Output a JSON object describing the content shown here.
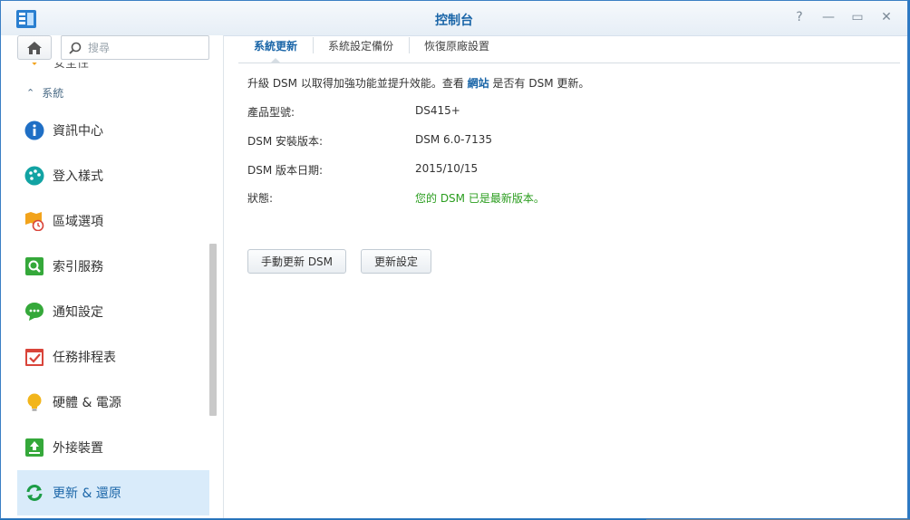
{
  "window": {
    "title": "控制台"
  },
  "titlebar_buttons": [
    {
      "name": "help-button",
      "icon": "help-icon",
      "glyph": "?"
    },
    {
      "name": "minimize-button",
      "icon": "minimize-icon",
      "glyph": "—"
    },
    {
      "name": "maximize-button",
      "icon": "maximize-icon",
      "glyph": "▭"
    },
    {
      "name": "close-button",
      "icon": "close-icon",
      "glyph": "✕"
    }
  ],
  "sidebar": {
    "search": {
      "placeholder": "搜尋",
      "value": ""
    },
    "partial_item": {
      "label": "安全性",
      "icon": "security-icon"
    },
    "group": {
      "label": "系統",
      "icon": "chevron-up-icon"
    },
    "items": [
      {
        "label": "資訊中心",
        "icon": "info-icon",
        "color": "#1f6fc5"
      },
      {
        "label": "登入樣式",
        "icon": "palette-icon",
        "color": "#12a3a3"
      },
      {
        "label": "區域選項",
        "icon": "regional-icon",
        "color": "#f2a31b"
      },
      {
        "label": "索引服務",
        "icon": "index-search-icon",
        "color": "#35a83a"
      },
      {
        "label": "通知設定",
        "icon": "chat-icon",
        "color": "#35a83a"
      },
      {
        "label": "任務排程表",
        "icon": "calendar-check-icon",
        "color": "#d9443a"
      },
      {
        "label": "硬體 & 電源",
        "icon": "bulb-icon",
        "color": "#f2b51b"
      },
      {
        "label": "外接裝置",
        "icon": "upload-icon",
        "color": "#35a83a"
      },
      {
        "label": "更新 & 還原",
        "icon": "refresh-icon",
        "color": "#1c9c46",
        "active": true
      }
    ]
  },
  "tabs": [
    {
      "label": "系統更新",
      "active": true
    },
    {
      "label": "系統設定備份",
      "active": false
    },
    {
      "label": "恢復原廠設置",
      "active": false
    }
  ],
  "intro": {
    "prefix": "升級 DSM 以取得加強功能並提升效能。查看",
    "link": "網站",
    "suffix": "是否有 DSM 更新。"
  },
  "info": {
    "model": {
      "label": "產品型號:",
      "value": "DS415+"
    },
    "version": {
      "label": "DSM 安裝版本:",
      "value": "DSM 6.0-7135"
    },
    "date": {
      "label": "DSM 版本日期:",
      "value": "2015/10/15"
    },
    "status": {
      "label": "狀態:",
      "value": "您的 DSM 已是最新版本。",
      "color": "#2a9d1e"
    }
  },
  "buttons": {
    "manual_update": "手動更新 DSM",
    "update_settings": "更新設定"
  },
  "colors": {
    "accent": "#1b66a8",
    "active_item_bg": "#d9ebfa"
  }
}
